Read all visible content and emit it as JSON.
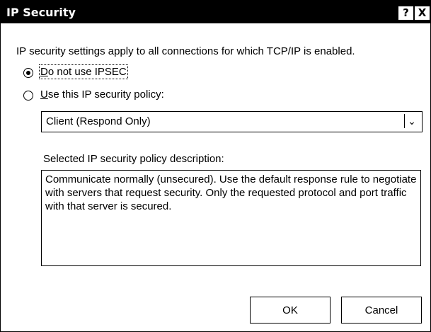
{
  "window": {
    "title": "IP Security",
    "help_label": "?",
    "close_label": "X"
  },
  "intro_text": "IP security settings apply to all connections for which TCP/IP is enabled.",
  "options": {
    "no_ipsec": {
      "accel": "D",
      "rest": "o not use IPSEC",
      "selected": true
    },
    "use_policy": {
      "accel": "U",
      "rest": "se this IP security policy:",
      "selected": false
    }
  },
  "policy_select": {
    "value": "Client (Respond Only)",
    "arrow_icon": "chevron-down-icon"
  },
  "description": {
    "label": "Selected IP security policy description:",
    "text": "Communicate normally (unsecured). Use the default response rule to negotiate with servers that request security. Only the requested protocol and port traffic with that server is secured."
  },
  "buttons": {
    "ok": "OK",
    "cancel": "Cancel"
  }
}
